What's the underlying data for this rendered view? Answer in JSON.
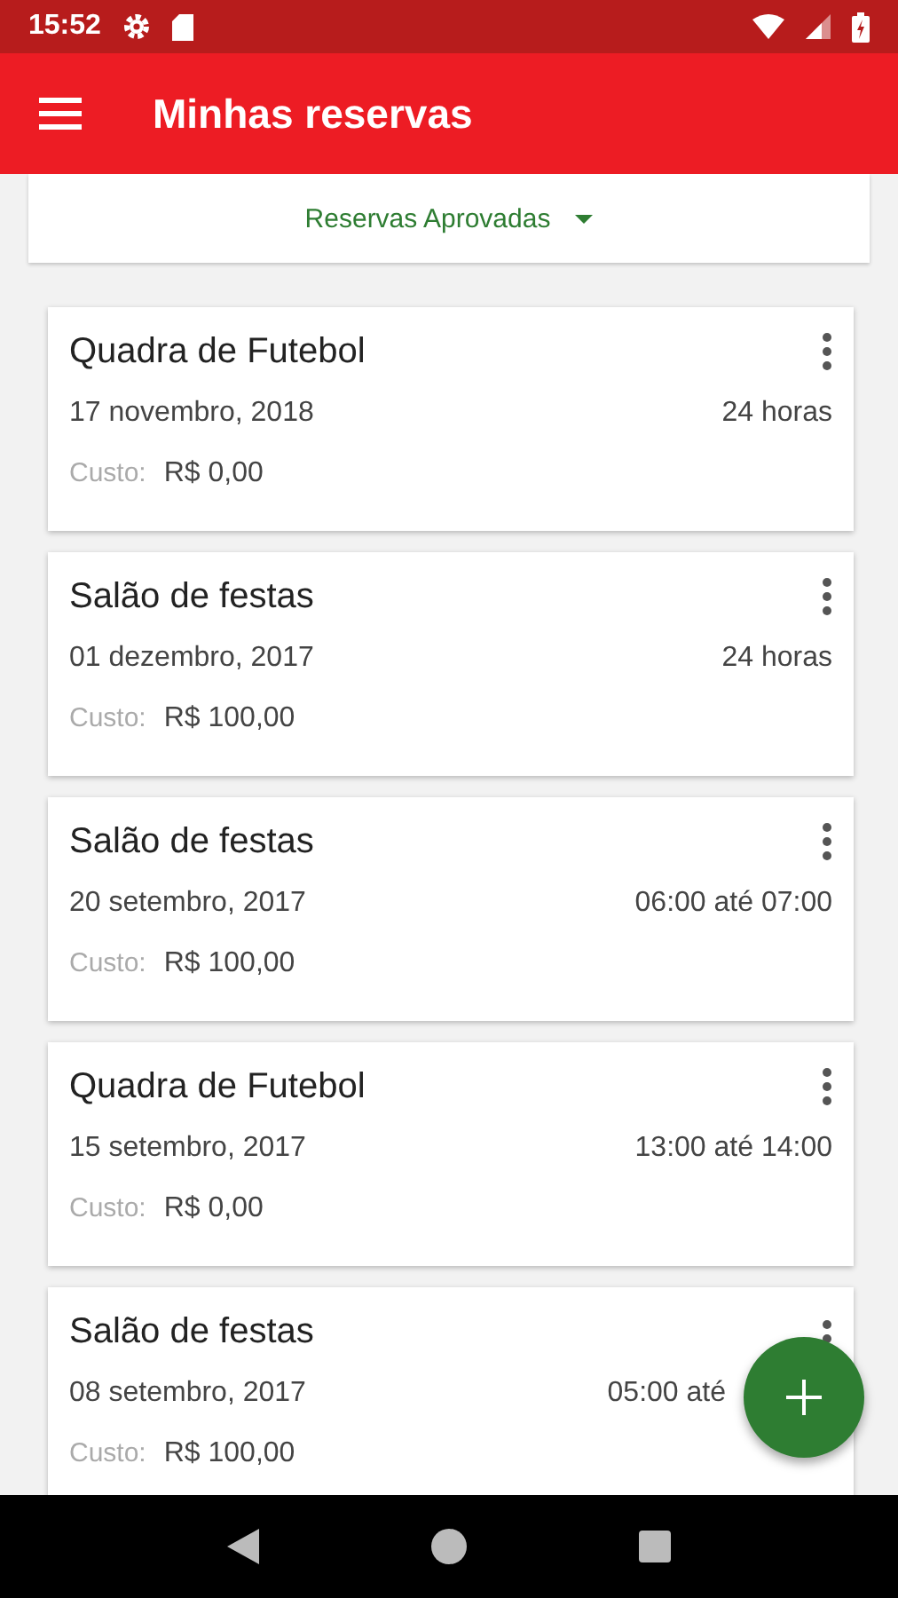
{
  "status_bar": {
    "time": "15:52"
  },
  "app_bar": {
    "title": "Minhas reservas"
  },
  "filter": {
    "label": "Reservas Aprovadas"
  },
  "reservations": [
    {
      "title": "Quadra de Futebol",
      "date": "17 novembro, 2018",
      "time": "24 horas",
      "cost_label": "Custo:",
      "cost": "R$ 0,00",
      "covered": false
    },
    {
      "title": "Salão de festas",
      "date": "01 dezembro, 2017",
      "time": "24 horas",
      "cost_label": "Custo:",
      "cost": "R$ 100,00",
      "covered": false
    },
    {
      "title": "Salão de festas",
      "date": "20 setembro, 2017",
      "time": "06:00 até 07:00",
      "cost_label": "Custo:",
      "cost": "R$ 100,00",
      "covered": false
    },
    {
      "title": "Quadra de Futebol",
      "date": "15 setembro, 2017",
      "time": "13:00 até 14:00",
      "cost_label": "Custo:",
      "cost": "R$ 0,00",
      "covered": false
    },
    {
      "title": "Salão de festas",
      "date": "08 setembro, 2017",
      "time": "05:00 até",
      "cost_label": "Custo:",
      "cost": "R$ 100,00",
      "covered": true
    }
  ]
}
